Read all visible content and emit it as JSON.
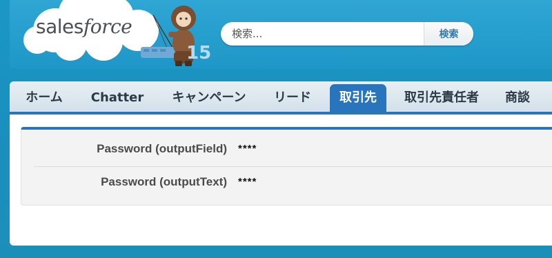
{
  "header": {
    "logo": {
      "brand_prefix": "sales",
      "brand_suffix": "force",
      "release": "15"
    },
    "search": {
      "placeholder": "検索...",
      "button_label": "検索"
    }
  },
  "tabs": [
    {
      "label": "ホーム",
      "active": false
    },
    {
      "label": "Chatter",
      "active": false
    },
    {
      "label": "キャンペーン",
      "active": false
    },
    {
      "label": "リード",
      "active": false
    },
    {
      "label": "取引先",
      "active": true
    },
    {
      "label": "取引先責任者",
      "active": false
    },
    {
      "label": "商談",
      "active": false
    }
  ],
  "detail": {
    "fields": [
      {
        "label": "Password (outputField)",
        "value": "****"
      },
      {
        "label": "Password (outputText)",
        "value": "****"
      }
    ]
  },
  "colors": {
    "page_background": "#1b97c6",
    "active_tab": "#2874bd",
    "tab_text": "#2a3a46",
    "search_button_text": "#2e7bb3"
  }
}
